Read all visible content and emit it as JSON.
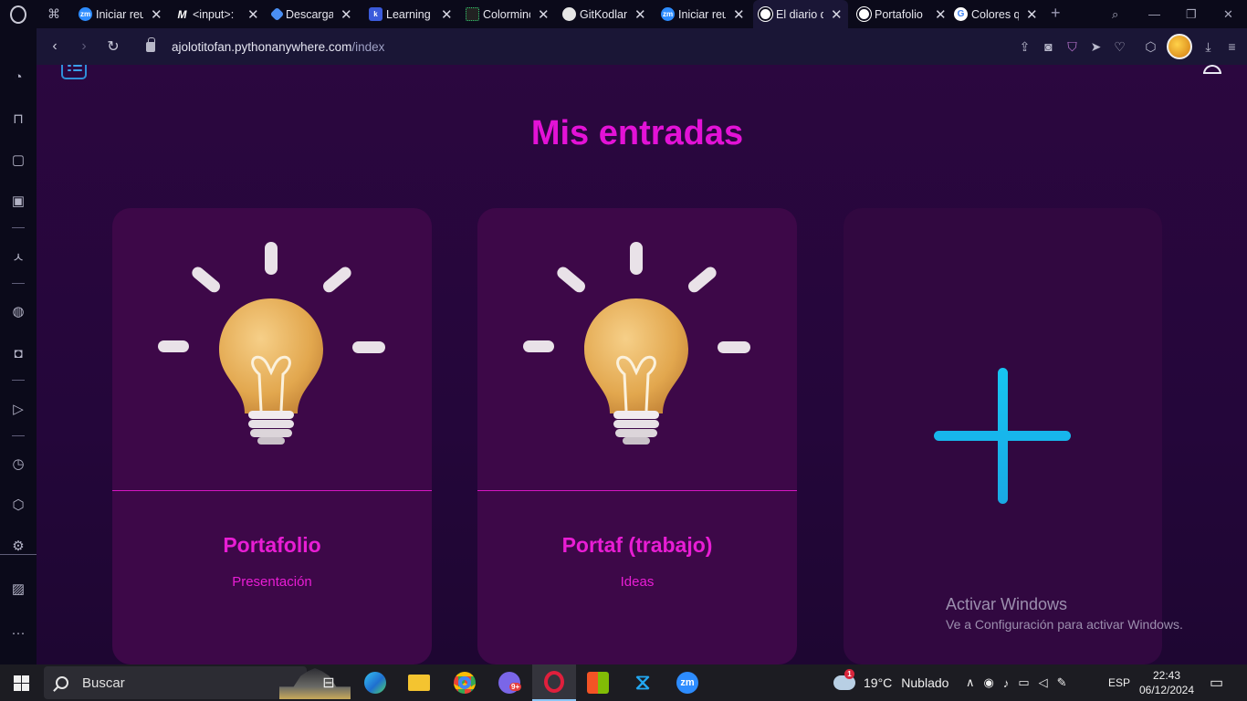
{
  "browser": {
    "tabs": [
      {
        "title": "Iniciar reu",
        "favicon": "zoom-icon",
        "color": "#2d8cff",
        "badge": "zm"
      },
      {
        "title": "<input>:",
        "favicon": "mdn-icon",
        "color": "#0b0a1a",
        "badge": "M"
      },
      {
        "title": "Descargar",
        "favicon": "heart-icon",
        "color": "#4a8ef2",
        "badge": ""
      },
      {
        "title": "Learning",
        "favicon": "k-icon",
        "color": "#3b5bdb",
        "badge": "k"
      },
      {
        "title": "Colorminc",
        "favicon": "colormind-icon",
        "color": "#222",
        "badge": ""
      },
      {
        "title": "GitKodlan",
        "favicon": "github-icon",
        "color": "#e6e6e6",
        "badge": ""
      },
      {
        "title": "Iniciar reu",
        "favicon": "zoom-icon",
        "color": "#2d8cff",
        "badge": "zm"
      },
      {
        "title": "El diario d",
        "favicon": "globe-icon",
        "color": "#ffffff",
        "badge": ""
      },
      {
        "title": "Portafolio",
        "favicon": "globe-icon",
        "color": "#ffffff",
        "badge": ""
      },
      {
        "title": "Colores q",
        "favicon": "google-icon",
        "color": "#ffffff",
        "badge": "G"
      }
    ],
    "url_host": "ajolotitofan.pythonanywhere.com",
    "url_path": "/index"
  },
  "page": {
    "title": "Mis entradas",
    "cards": [
      {
        "title": "Portafolio",
        "subtitle": "Presentación"
      },
      {
        "title": "Portaf (trabajo)",
        "subtitle": "Ideas"
      }
    ],
    "add_card_icon": "plus-icon"
  },
  "overlay": {
    "activate_title": "Activar Windows",
    "activate_sub": "Ve a Configuración para activar Windows."
  },
  "taskbar": {
    "search_placeholder": "Buscar",
    "weather_badge": "1",
    "temperature": "19°C",
    "weather": "Nublado",
    "language": "ESP",
    "time": "22:43",
    "date": "06/12/2024",
    "discord_badge": "9+"
  },
  "colors": {
    "accent_magenta": "#e312d6",
    "plus_cyan": "#17b6ec",
    "card_bg": "#3d0848",
    "page_bg": "#2b073f"
  }
}
